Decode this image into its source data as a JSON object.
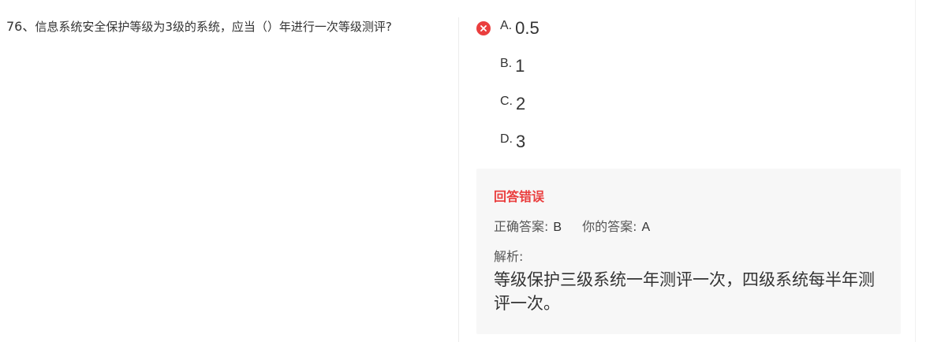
{
  "question": {
    "number": "76、",
    "text": "信息系统安全保护等级为3级的系统，应当（）年进行一次等级测评?"
  },
  "options": [
    {
      "letter": "A.",
      "text": "0.5",
      "status": "wrong"
    },
    {
      "letter": "B.",
      "text": "1"
    },
    {
      "letter": "C.",
      "text": "2"
    },
    {
      "letter": "D.",
      "text": "3"
    }
  ],
  "result": {
    "title": "回答错误",
    "correct_label": "正确答案:",
    "correct_value": "B",
    "yours_label": "你的答案:",
    "yours_value": "A",
    "analysis_label": "解析:",
    "analysis_text": "等级保护三级系统一年测评一次，四级系统每半年测评一次。"
  },
  "colors": {
    "error": "#ea3e3e",
    "panel_bg": "#f7f7f7"
  },
  "icons": {
    "wrong": "close-circle-icon"
  }
}
